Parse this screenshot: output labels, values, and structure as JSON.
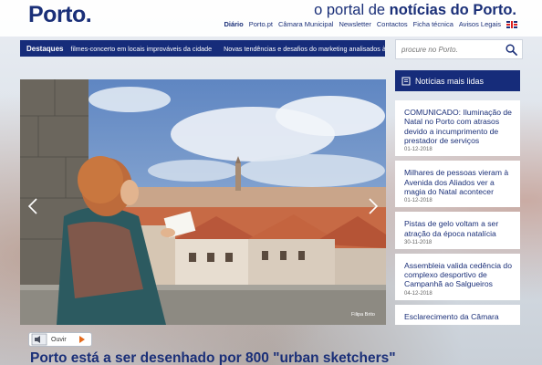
{
  "brand": {
    "logo": "Porto.",
    "tagline_pre": "o portal de ",
    "tagline_bold": "notícias do Porto."
  },
  "topnav": [
    "Diário",
    "Porto.pt",
    "Câmara Municipal",
    "Newsletter",
    "Contactos",
    "Ficha técnica",
    "Avisos Legais"
  ],
  "ticker": {
    "label": "Destaques",
    "items": [
      "filmes-concerto em locais improváveis da cidade",
      "Novas tendências e desafios do marketing analisados à lu"
    ]
  },
  "search": {
    "placeholder": "procure no Porto."
  },
  "hero": {
    "credit": "Filipa Brito"
  },
  "audio": {
    "label": "Ouvir"
  },
  "headline": "Porto está a ser desenhado por 800 \"urban sketchers\"",
  "most_read": {
    "title": "Notícias mais lidas",
    "items": [
      {
        "title": "COMUNICADO: Iluminação de Natal no Porto com atrasos devido a incumprimento de prestador de serviços",
        "date": "01-12-2018"
      },
      {
        "title": "Milhares de pessoas vieram à Avenida dos Aliados ver a magia do Natal acontecer",
        "date": "01-12-2018"
      },
      {
        "title": "Pistas de gelo voltam a ser atração da época natalícia",
        "date": "30-11-2018"
      },
      {
        "title": "Assembleia valida cedência do complexo desportivo de Campanhã ao Salgueiros",
        "date": "04-12-2018"
      },
      {
        "title": "Esclarecimento da Câmara",
        "date": ""
      }
    ]
  },
  "colors": {
    "brand_navy": "#1a2f78",
    "ticker_bg": "#162c7a",
    "play_orange": "#e56a1b"
  }
}
